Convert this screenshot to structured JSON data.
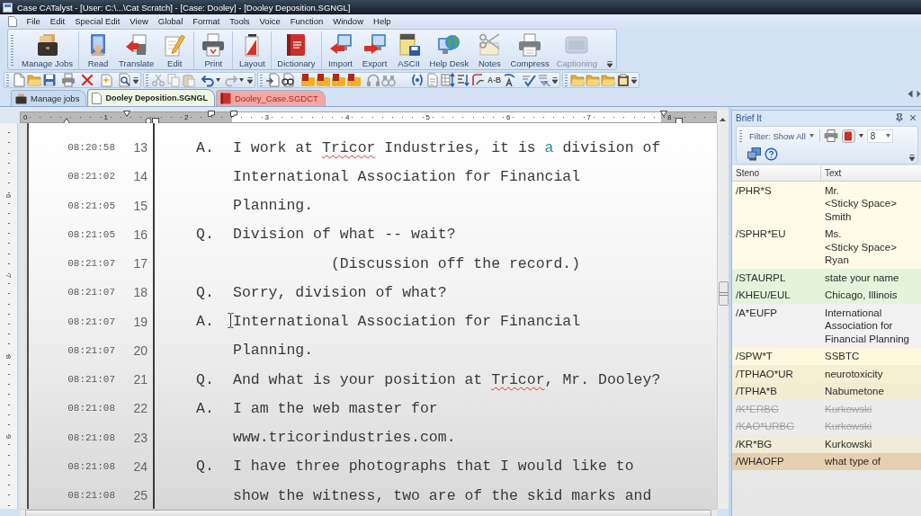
{
  "window": {
    "title": "Case CATalyst - [User: C:\\...\\Cat Scratch] - [Case: Dooley] - [Dooley Deposition.SGNGL]"
  },
  "menu": [
    "File",
    "Edit",
    "Special Edit",
    "View",
    "Global",
    "Format",
    "Tools",
    "Voice",
    "Function",
    "Window",
    "Help"
  ],
  "ribbon": {
    "groups": [
      {
        "buttons": [
          {
            "label": "Manage Jobs",
            "disabled": false
          }
        ]
      },
      {
        "buttons": [
          {
            "label": "Read",
            "disabled": false
          },
          {
            "label": "Translate",
            "disabled": false
          },
          {
            "label": "Edit",
            "disabled": false
          }
        ]
      },
      {
        "buttons": [
          {
            "label": "Print",
            "disabled": false
          }
        ]
      },
      {
        "buttons": [
          {
            "label": "Layout",
            "disabled": false
          }
        ]
      },
      {
        "buttons": [
          {
            "label": "Dictionary",
            "disabled": false
          }
        ]
      },
      {
        "buttons": [
          {
            "label": "Import",
            "disabled": false
          },
          {
            "label": "Export",
            "disabled": false
          },
          {
            "label": "ASCII",
            "disabled": false
          },
          {
            "label": "Help Desk",
            "disabled": false
          },
          {
            "label": "Notes",
            "disabled": false
          },
          {
            "label": "Compress",
            "disabled": false
          },
          {
            "label": "Captioning",
            "disabled": true
          }
        ]
      }
    ]
  },
  "format_toolbar": {
    "text_button": "A-B"
  },
  "tabs": [
    {
      "label": "Manage jobs",
      "selected": false,
      "color": "#c7daf0"
    },
    {
      "label": "Dooley Deposition.SGNGL",
      "selected": true,
      "color": "#eef6e4"
    },
    {
      "label": "Dooley_Case.SGDCT",
      "selected": false,
      "color": "#f1a9a2"
    }
  ],
  "ruler": {
    "labels": [
      "0",
      "1",
      "2",
      "3",
      "4",
      "5",
      "6",
      "7",
      "8"
    ]
  },
  "vertical_ruler": {
    "labels": [
      "6",
      "7",
      "8",
      "9"
    ]
  },
  "transcript": {
    "lines": [
      {
        "time": "08:20:58",
        "number": "13",
        "speaker": "A.",
        "kind": "testimony",
        "segments": [
          {
            "text": "I work at ",
            "kind": "plain"
          },
          {
            "text": "Tricor",
            "kind": "misspelled"
          },
          {
            "text": " Industries, it is ",
            "kind": "plain"
          },
          {
            "text": "a",
            "kind": "highlight"
          },
          {
            "text": " division of",
            "kind": "plain"
          }
        ]
      },
      {
        "time": "08:21:02",
        "number": "14",
        "kind": "testimony",
        "text": "International Association for Financial"
      },
      {
        "time": "08:21:05",
        "number": "15",
        "kind": "testimony",
        "text": "Planning."
      },
      {
        "time": "08:21:05",
        "number": "16",
        "speaker": "Q.",
        "kind": "testimony",
        "text": "Division of what -- wait?"
      },
      {
        "time": "08:21:07",
        "number": "17",
        "kind": "parenthetical",
        "text": "(Discussion off the record.)"
      },
      {
        "time": "08:21:07",
        "number": "18",
        "speaker": "Q.",
        "kind": "testimony",
        "text": "Sorry, division of what?"
      },
      {
        "time": "08:21:07",
        "number": "19",
        "speaker": "A.",
        "kind": "testimony",
        "text": "International Association for Financial"
      },
      {
        "time": "08:21:07",
        "number": "20",
        "kind": "testimony",
        "text": "Planning."
      },
      {
        "time": "08:21:07",
        "number": "21",
        "speaker": "Q.",
        "kind": "testimony",
        "segments": [
          {
            "text": "And what is your position at ",
            "kind": "plain"
          },
          {
            "text": "Tricor",
            "kind": "misspelled"
          },
          {
            "text": ", Mr. Dooley?",
            "kind": "plain"
          }
        ]
      },
      {
        "time": "08:21:08",
        "number": "22",
        "speaker": "A.",
        "kind": "testimony",
        "text": "I am the web master for"
      },
      {
        "time": "08:21:08",
        "number": "23",
        "kind": "testimony",
        "text": "www.tricorindustries.com."
      },
      {
        "time": "08:21:08",
        "number": "24",
        "speaker": "Q.",
        "kind": "testimony",
        "text": "I have three photographs that I would like to"
      },
      {
        "time": "08:21:08",
        "number": "25",
        "kind": "testimony",
        "text": "show the witness, two are of the skid marks and"
      }
    ]
  },
  "brief_it": {
    "title": "Brief It",
    "filter": "Filter: Show All",
    "size": "8",
    "columns": [
      "Steno",
      "Text"
    ],
    "rows": [
      {
        "steno": "/PHR*S",
        "text": "Mr.\n<Sticky Space>\nSmith",
        "color": "#fdfbe6",
        "deleted": false
      },
      {
        "steno": "/SPHR*EU",
        "text": "Ms.\n<Sticky Space>\nRyan",
        "color": "#fdfbe6",
        "deleted": false
      },
      {
        "steno": "/STAURPL",
        "text": "state your name",
        "color": "#e3f4da",
        "deleted": false
      },
      {
        "steno": "/KHEU/EUL",
        "text": "Chicago, Illinois",
        "color": "#e3f4da",
        "deleted": false
      },
      {
        "steno": "/A*EUFP",
        "text": "International Association for Financial Planning",
        "color": "#f1f1f1",
        "deleted": false
      },
      {
        "steno": "/SPW*T",
        "text": "SSBTC",
        "color": "#fbf8dd",
        "deleted": false
      },
      {
        "steno": "/TPHAO*UR",
        "text": "neurotoxicity",
        "color": "#f5efd3",
        "deleted": false
      },
      {
        "steno": "/TPHA*B",
        "text": "Nabumetone",
        "color": "#f2ecd1",
        "deleted": false
      },
      {
        "steno": "/K*ERBG",
        "text": "Kurkowski",
        "color": "#ececec",
        "deleted": true
      },
      {
        "steno": "/KAO*URBG",
        "text": "Kurkowski",
        "color": "#ececec",
        "deleted": true
      },
      {
        "steno": "/KR*BG",
        "text": "Kurkowski",
        "color": "#f0ecd7",
        "deleted": false
      },
      {
        "steno": "/WHAOFP",
        "text": "what type of",
        "color": "#e6cfae",
        "deleted": false
      }
    ]
  }
}
